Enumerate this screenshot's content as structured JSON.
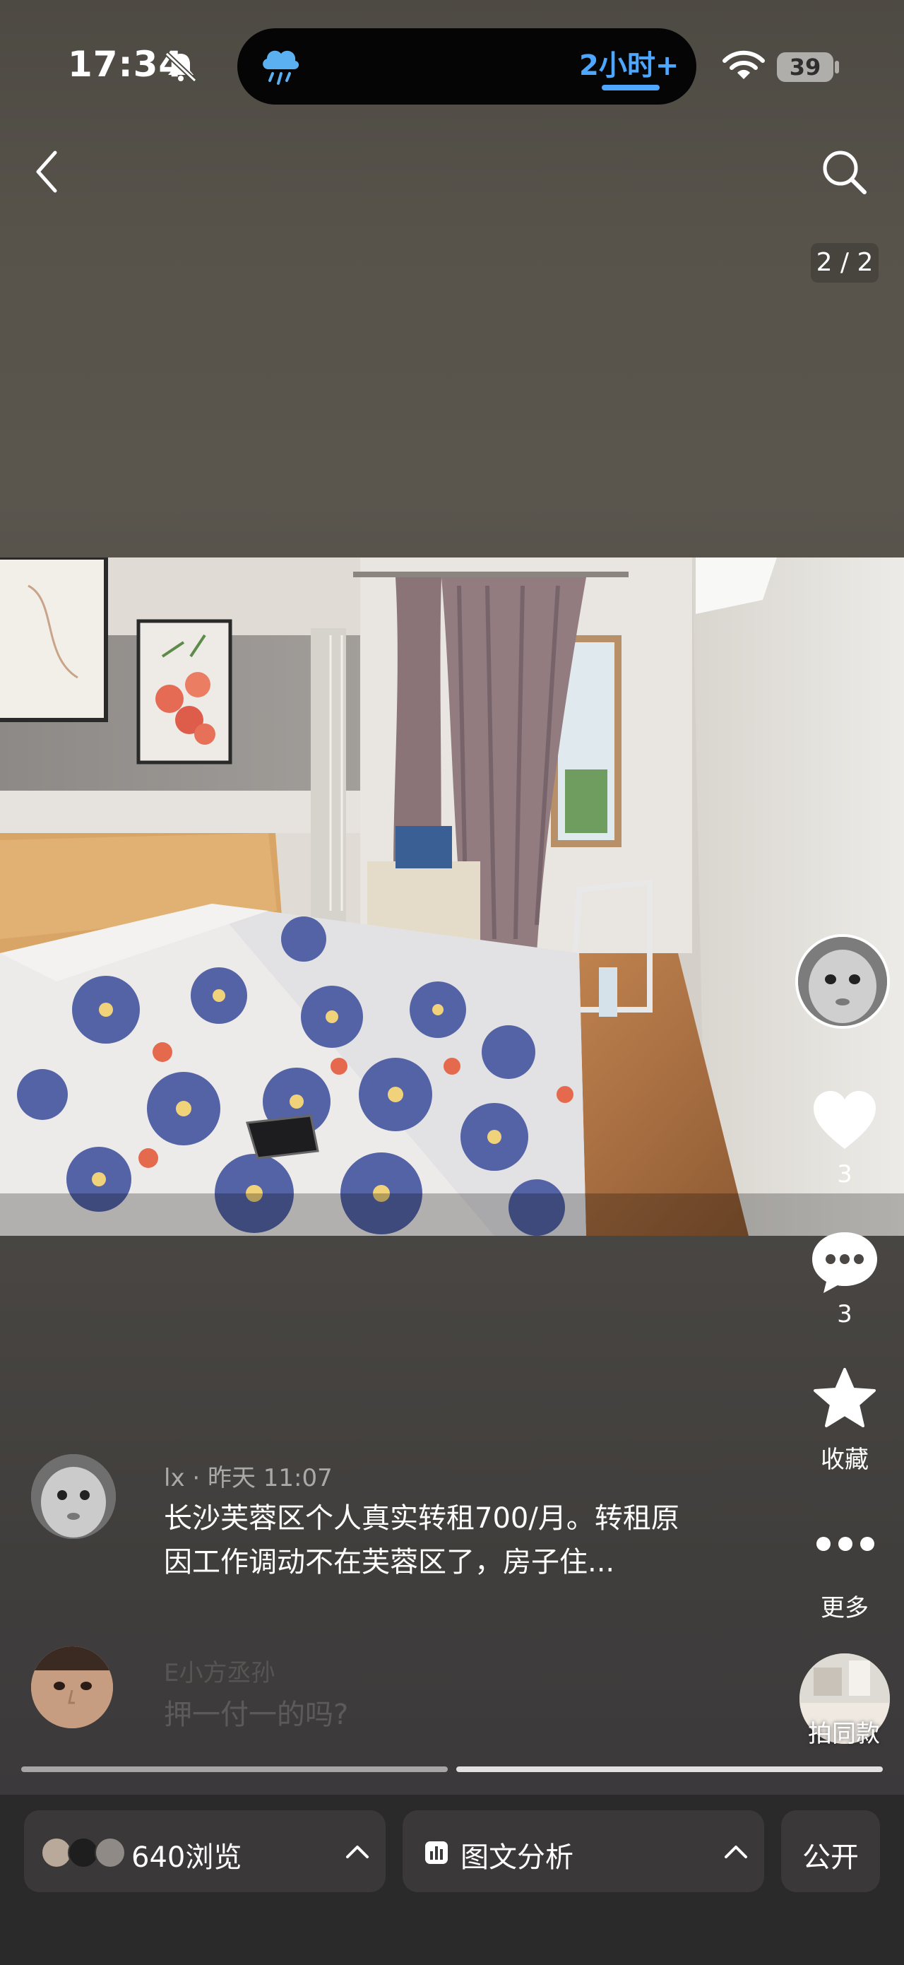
{
  "status_bar": {
    "time": "17:34",
    "island_text": "2小时+",
    "battery": "39"
  },
  "nav": {
    "page_indicator": "2 / 2"
  },
  "actions": {
    "likes": "3",
    "comments": "3",
    "favorite_label": "收藏",
    "more_label": "更多",
    "same_style_label": "拍同款"
  },
  "comments": [
    {
      "meta": "lx · 昨天 11:07",
      "text": "长沙芙蓉区个人真实转租700/月。转租原因工作调动不在芙蓉区了，房子住..."
    },
    {
      "meta": "E小方丞孙",
      "text": "押一付一的吗?"
    }
  ],
  "bottom_bar": {
    "views_label": "640浏览",
    "analysis_label": "图文分析",
    "public_label": "公开"
  },
  "colors": {
    "accent_blue": "#4da6ff",
    "background": "#4d4a43",
    "bottom_bar": "#2b2a2a"
  },
  "icons": [
    "bell-slash-icon",
    "cloud-rain-icon",
    "wifi-icon",
    "back-icon",
    "search-icon",
    "heart-icon",
    "comment-icon",
    "star-icon",
    "more-icon",
    "chevron-up-icon",
    "chart-icon"
  ]
}
